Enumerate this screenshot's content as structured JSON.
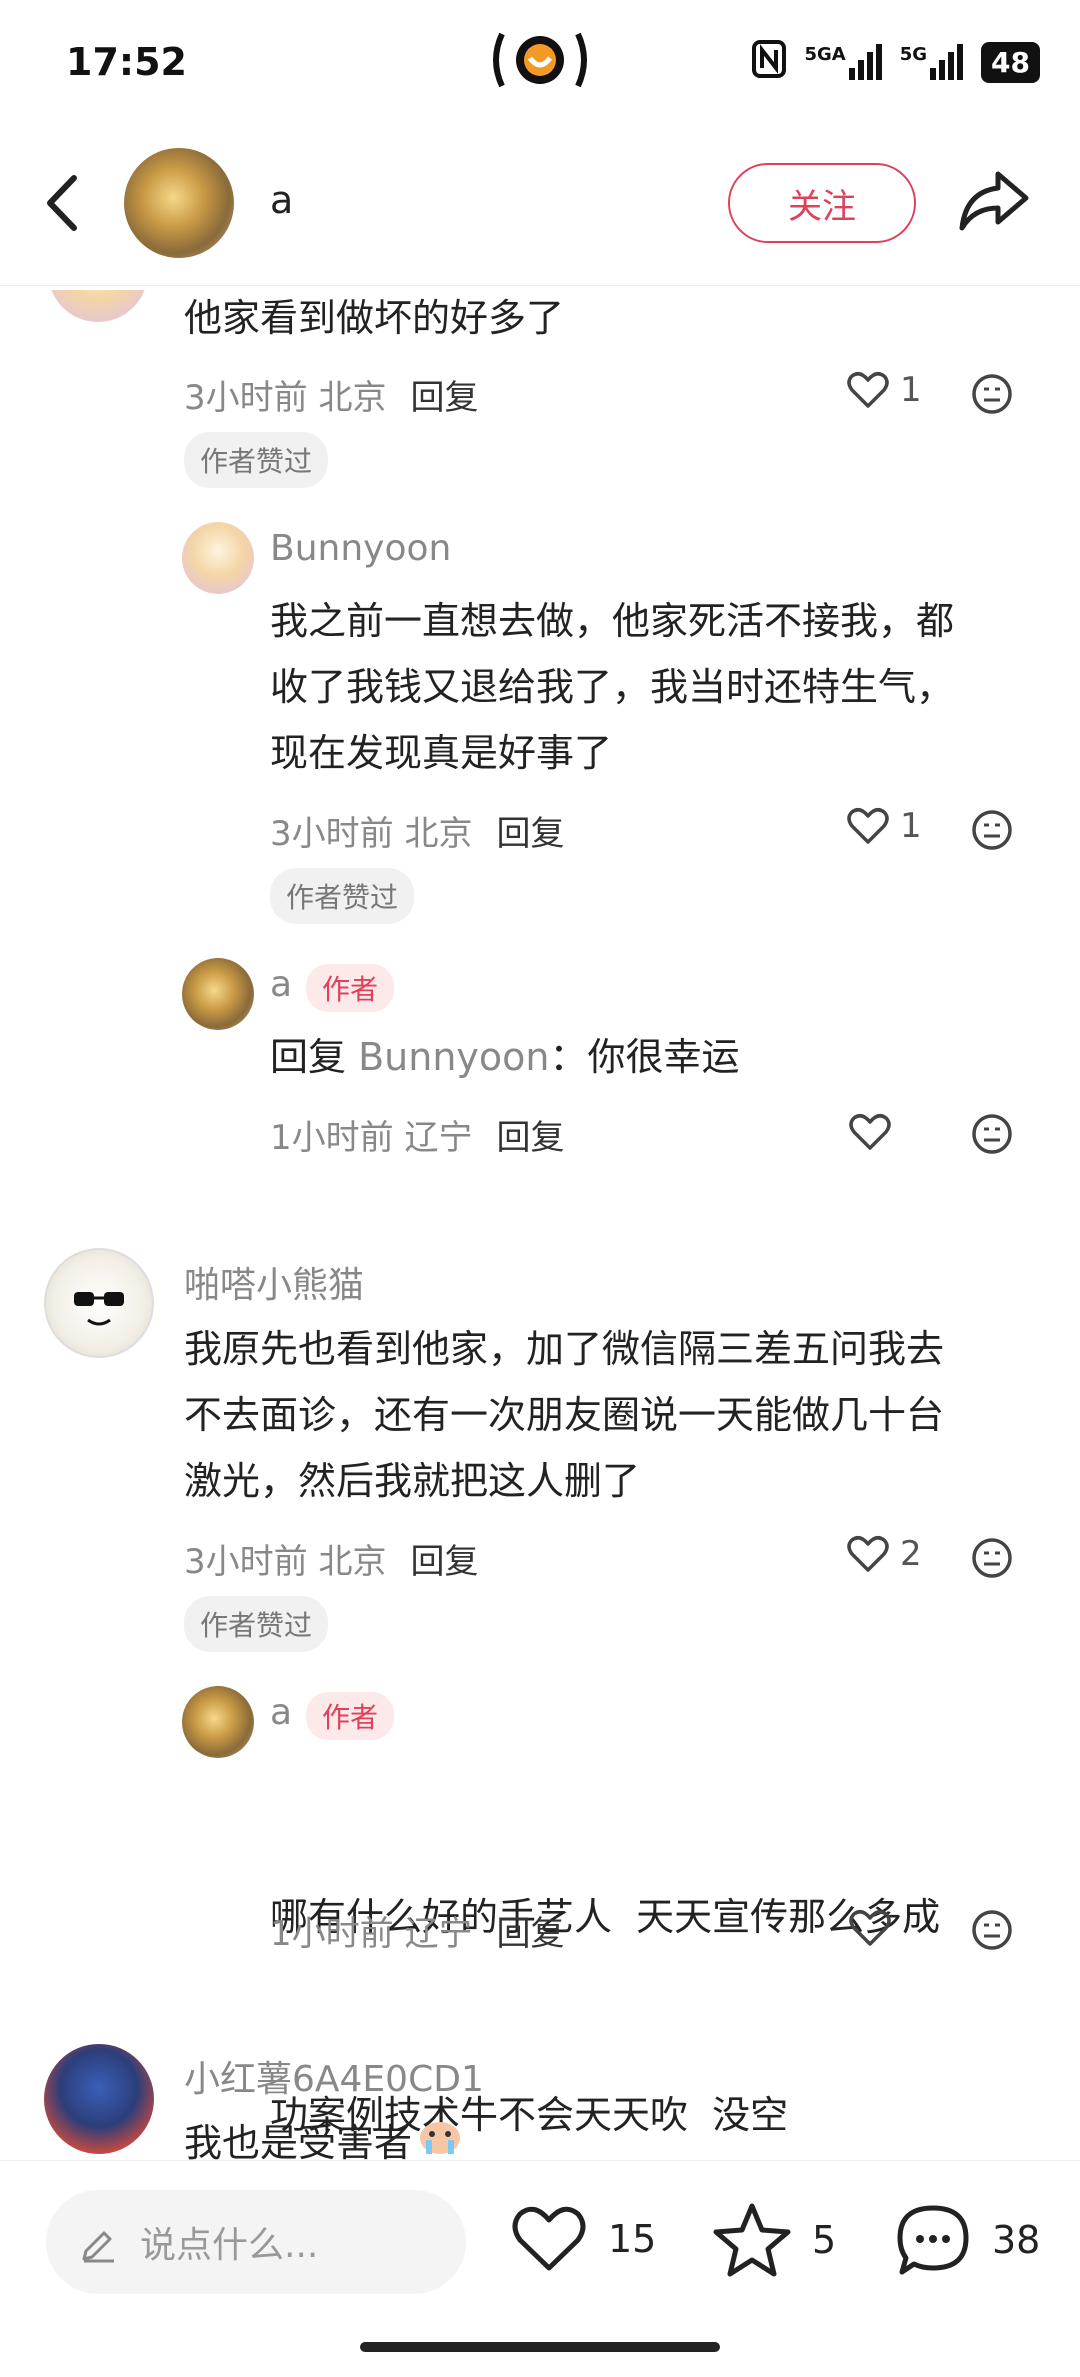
{
  "status_bar": {
    "time": "17:52",
    "network1": "5GA",
    "network2": "5G",
    "battery": "48"
  },
  "header": {
    "username": "a",
    "follow_label": "关注"
  },
  "comments": [
    {
      "text": "他家看到做坏的好多了",
      "time_location": "3小时前 北京",
      "reply_label": "回复",
      "likes": "1",
      "badge": "作者赞过"
    },
    {
      "name": "Bunnyoon",
      "text_lines": [
        "我之前一直想去做，他家死活不接我，都",
        "收了我钱又退给我了，我当时还特生气，",
        "现在发现真是好事了"
      ],
      "time_location": "3小时前 北京",
      "reply_label": "回复",
      "likes": "1",
      "badge": "作者赞过"
    },
    {
      "name": "a",
      "author_tag": "作者",
      "reply_prefix": "回复",
      "reply_to": "Bunnyoon",
      "text": "：你很幸运",
      "time_location": "1小时前 辽宁",
      "reply_label": "回复"
    },
    {
      "name": "啪嗒小熊猫",
      "text_lines": [
        "我原先也看到他家，加了微信隔三差五问我去",
        "不去面诊，还有一次朋友圈说一天能做几十台",
        "激光，然后我就把这人删了"
      ],
      "time_location": "3小时前 北京",
      "reply_label": "回复",
      "likes": "2",
      "badge": "作者赞过"
    },
    {
      "name": "a",
      "author_tag": "作者",
      "text_lines": [
        "哪有什么好的手艺人  天天宣传那么多成",
        "功案例技术牛不会天天吹  没空"
      ],
      "time_location": "1小时前 辽宁",
      "reply_label": "回复"
    },
    {
      "name": "小红薯6A4E0CD1",
      "text": "我也是受害者"
    }
  ],
  "bottom": {
    "input_placeholder": "说点什么...",
    "likes": "15",
    "favorites": "5",
    "comments": "38"
  }
}
